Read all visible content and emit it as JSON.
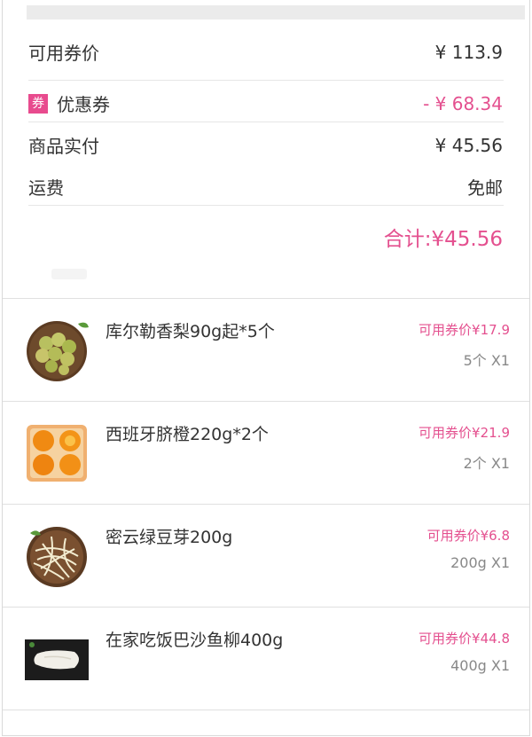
{
  "summary": {
    "voucher_price_label": "可用券价",
    "voucher_price_value": "¥ 113.9",
    "coupon_tag": "券",
    "coupon_label": "优惠券",
    "coupon_value": "- ¥ 68.34",
    "paid_label": "商品实付",
    "paid_value": "¥ 45.56",
    "shipping_label": "运费",
    "shipping_value": "免邮",
    "total": "合计:¥45.56"
  },
  "items": [
    {
      "name": "库尔勒香梨90g起*5个",
      "price": "可用券价¥17.9",
      "qty": "5个 X1",
      "image": "pears-image"
    },
    {
      "name": "西班牙脐橙220g*2个",
      "price": "可用券价¥21.9",
      "qty": "2个 X1",
      "image": "oranges-image"
    },
    {
      "name": "密云绿豆芽200g",
      "price": "可用券价¥6.8",
      "qty": "200g X1",
      "image": "bean-sprouts-image"
    },
    {
      "name": "在家吃饭巴沙鱼柳400g",
      "price": "可用券价¥44.8",
      "qty": "400g X1",
      "image": "fish-fillet-image"
    }
  ],
  "colors": {
    "accent": "#e4508f",
    "coupon_tag_bg": "#e84b8e"
  }
}
